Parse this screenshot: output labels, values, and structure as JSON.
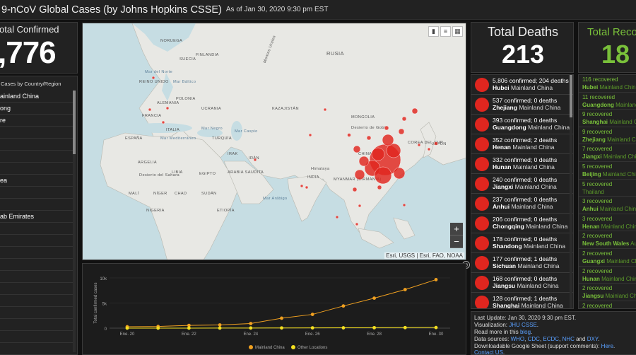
{
  "header": {
    "title": "9-nCoV Global Cases (by Johns Hopkins CSSE)",
    "as_of": "As of Jan 30, 2020 9:30 pm EST"
  },
  "confirmed": {
    "label": "otal Confirmed",
    "value": ",776"
  },
  "countries": {
    "heading": "Cases by Country/Region",
    "items": [
      "ainland China",
      "ong",
      "re",
      "",
      "",
      "",
      "",
      "ea",
      "",
      "",
      "ab Emirates",
      "",
      "",
      "",
      "",
      "",
      "",
      "",
      "",
      "",
      "",
      ""
    ]
  },
  "map": {
    "attribution": "Esri, USGS | Esri, FAO, NOAA",
    "zoom_in": "+",
    "zoom_out": "−",
    "labels": {
      "rusia": "RUSIA",
      "noruega": "NORUEGA",
      "suecia": "SUECIA",
      "finlandia": "FINLANDIA",
      "reino_unido": "REINO UNIDO",
      "alemania": "ALEMANIA",
      "polonia": "POLONIA",
      "ucrania": "UCRANIA",
      "francia": "FRANCIA",
      "espana": "ESPAÑA",
      "italia": "ITALIA",
      "turquia": "TURQUÍA",
      "kazajistan": "KAZAJISTÁN",
      "mongolia": "MONGOLIA",
      "china": "CHINA",
      "irak": "IRAK",
      "iran": "IRÁN",
      "desierto_sahara": "Desierto del Sahara",
      "argelia": "ARGELIA",
      "libia": "LIBIA",
      "egipto": "EGIPTO",
      "arabia": "ARABIA SAUDITA",
      "mali": "MALÍ",
      "niger": "NÍGER",
      "chad": "CHAD",
      "sudan": "SUDÁN",
      "nigeria": "NIGERIA",
      "etiopia": "ETIOPÍA",
      "india": "INDIA",
      "mar_arabigo": "Mar Arábigo",
      "himalaya": "Himalaya",
      "myanmar": "MYANMAR (BIRMANIA)",
      "gobi": "Desierto de Gobi",
      "japon": "JAPÓN",
      "corea": "COREA DEL SUR",
      "montes_urales": "Montes Urales",
      "mar_negro": "Mar Negro",
      "mar_caspio": "Mar Caspio",
      "mar_mediterraneo": "Mar Mediterráneo",
      "mar_baltico": "Mar Báltico",
      "mar_norte": "Mar del Norte"
    }
  },
  "chart_data": {
    "type": "line",
    "x": [
      "Ene. 20",
      "Ene. 21",
      "Ene. 22",
      "Ene. 23",
      "Ene. 24",
      "Ene. 25",
      "Ene. 26",
      "Ene. 27",
      "Ene. 28",
      "Ene. 29",
      "Ene. 30"
    ],
    "x_tick_labels": [
      "Ene. 20",
      "Ene. 22",
      "Ene. 24",
      "Ene. 26",
      "Ene. 28",
      "Ene. 30"
    ],
    "ylabel": "Total confirmed cases",
    "y_tick_labels": [
      "0",
      "5k",
      "10k"
    ],
    "ylim": [
      0,
      10000
    ],
    "series": [
      {
        "name": "Mainland China",
        "color": "#f0a020",
        "values": [
          278,
          326,
          547,
          639,
          916,
          1979,
          2737,
          4409,
          5970,
          7678,
          9658
        ]
      },
      {
        "name": "Other Locations",
        "color": "#f5e020",
        "values": [
          4,
          6,
          8,
          14,
          25,
          40,
          57,
          64,
          87,
          105,
          118
        ]
      }
    ],
    "legend_position": "bottom"
  },
  "deaths": {
    "label": "Total Deaths",
    "value": "213",
    "items": [
      {
        "confirmed": "5,806 confirmed;",
        "deaths": "204 deaths",
        "place": "Hubei",
        "region": "Mainland China"
      },
      {
        "confirmed": "537 confirmed;",
        "deaths": "0 deaths",
        "place": "Zhejiang",
        "region": "Mainland China"
      },
      {
        "confirmed": "393 confirmed;",
        "deaths": "0 deaths",
        "place": "Guangdong",
        "region": "Mainland China"
      },
      {
        "confirmed": "352 confirmed;",
        "deaths": "2 deaths",
        "place": "Henan",
        "region": "Mainland China"
      },
      {
        "confirmed": "332 confirmed;",
        "deaths": "0 deaths",
        "place": "Hunan",
        "region": "Mainland China"
      },
      {
        "confirmed": "240 confirmed;",
        "deaths": "0 deaths",
        "place": "Jiangxi",
        "region": "Mainland China"
      },
      {
        "confirmed": "237 confirmed;",
        "deaths": "0 deaths",
        "place": "Anhui",
        "region": "Mainland China"
      },
      {
        "confirmed": "206 confirmed;",
        "deaths": "0 deaths",
        "place": "Chongqing",
        "region": "Mainland China"
      },
      {
        "confirmed": "178 confirmed;",
        "deaths": "0 deaths",
        "place": "Shandong",
        "region": "Mainland China"
      },
      {
        "confirmed": "177 confirmed;",
        "deaths": "1 deaths",
        "place": "Sichuan",
        "region": "Mainland China"
      },
      {
        "confirmed": "168 confirmed;",
        "deaths": "0 deaths",
        "place": "Jiangsu",
        "region": "Mainland China"
      },
      {
        "confirmed": "128 confirmed;",
        "deaths": "1 deaths",
        "place": "Shanghai",
        "region": "Mainland China"
      }
    ]
  },
  "recovered": {
    "label": "Total Reco",
    "value": "18",
    "items": [
      {
        "count": "116 recovered",
        "place": "Hubei",
        "region": "Mainland China"
      },
      {
        "count": "11 recovered",
        "place": "Guangdong",
        "region": "Mainland China"
      },
      {
        "count": "9 recovered",
        "place": "Shanghai",
        "region": "Mainland China"
      },
      {
        "count": "9 recovered",
        "place": "Zhejiang",
        "region": "Mainland China"
      },
      {
        "count": "7 recovered",
        "place": "Jiangxi",
        "region": "Mainland China"
      },
      {
        "count": "5 recovered",
        "place": "Beijing",
        "region": "Mainland China"
      },
      {
        "count": "5 recovered",
        "place": "",
        "region": "Thailand"
      },
      {
        "count": "3 recovered",
        "place": "Anhui",
        "region": "Mainland China"
      },
      {
        "count": "3 recovered",
        "place": "Henan",
        "region": "Mainland China"
      },
      {
        "count": "2 recovered",
        "place": "New South Wales",
        "region": "Australia"
      },
      {
        "count": "2 recovered",
        "place": "Guangxi",
        "region": "Mainland China"
      },
      {
        "count": "2 recovered",
        "place": "Hunan",
        "region": "Mainland China"
      },
      {
        "count": "2 recovered",
        "place": "Jiangsu",
        "region": "Mainland China"
      },
      {
        "count": "2 recovered",
        "place": "",
        "region": ""
      }
    ]
  },
  "info": {
    "last_update": "Last Update: Jan 30, 2020 9:30 pm EST.",
    "visualization_label": "Visualization:",
    "visualization_link": "JHU CSSE",
    "read_more_prefix": "Read more in this",
    "read_more_link": "blog",
    "data_sources_label": "Data sources:",
    "sources": [
      "WHO",
      "CDC",
      "ECDC",
      "NHC",
      "DXY"
    ],
    "sheet_text": "Downloadable Google Sheet (support comments):",
    "sheet_link": "Here",
    "contact_link": "Contact US"
  },
  "colors": {
    "accent_red": "#e0261f",
    "recovered_green": "#79c03a",
    "china_line": "#f0a020",
    "other_line": "#f5e020",
    "link_blue": "#5aa0ff"
  }
}
